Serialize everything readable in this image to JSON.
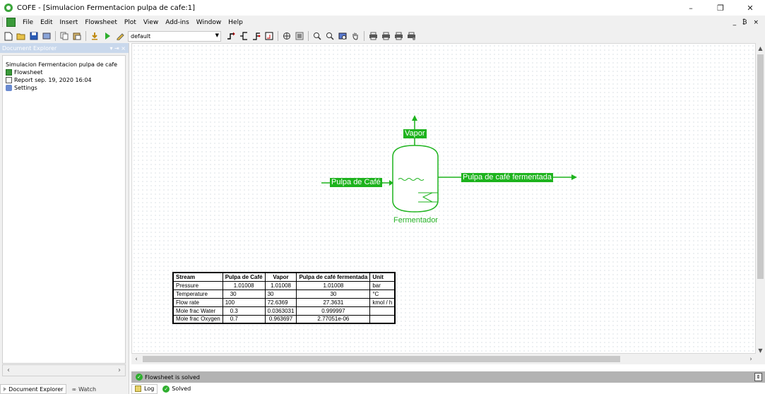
{
  "window": {
    "title": "COFE - [Simulacion Fermentacion pulpa de cafe:1]",
    "controls": [
      "–",
      "❐",
      "✕"
    ]
  },
  "menu": {
    "items": [
      "File",
      "Edit",
      "Insert",
      "Flowsheet",
      "Plot",
      "View",
      "Add-ins",
      "Window",
      "Help"
    ],
    "mdi_controls": "_ ₿ ×"
  },
  "toolbar": {
    "combo_value": "default"
  },
  "doc_explorer": {
    "header": "Document Explorer",
    "header_controls": "▾ ⇥ ×",
    "tree": {
      "root": "Simulacion Fermentacion pulpa de cafe",
      "items": [
        "Flowsheet",
        "Report sep. 19, 2020 16:04",
        "Settings"
      ]
    },
    "tabs": [
      "Document Explorer",
      "Watch"
    ]
  },
  "flowsheet": {
    "streams": {
      "feed": "Pulpa de Café",
      "vapor": "Vapor",
      "product": "Pulpa de café fermentada"
    },
    "unit": "Fermentador",
    "accent_color": "#1db31d"
  },
  "stream_table": {
    "headers": [
      "Stream",
      "Pulpa de Café",
      "Vapor",
      "Pulpa de café fermentada",
      "Unit"
    ],
    "rows": [
      [
        "Pressure",
        "1.01008",
        "1.01008",
        "1.01008",
        "bar"
      ],
      [
        "Temperature",
        "30",
        "30",
        "30",
        "°C"
      ],
      [
        "Flow rate",
        "100",
        "72.6369",
        "27.3631",
        "kmol / h"
      ],
      [
        "Mole frac Water",
        "0.3",
        "0.0363031",
        "0.999997",
        ""
      ],
      [
        "Mole frac Oxygen",
        "0.7",
        "0.963697",
        "2.77051e-06",
        ""
      ]
    ]
  },
  "status": {
    "message": "Flowsheet is solved",
    "tabs": [
      "Log",
      "Solved"
    ]
  }
}
